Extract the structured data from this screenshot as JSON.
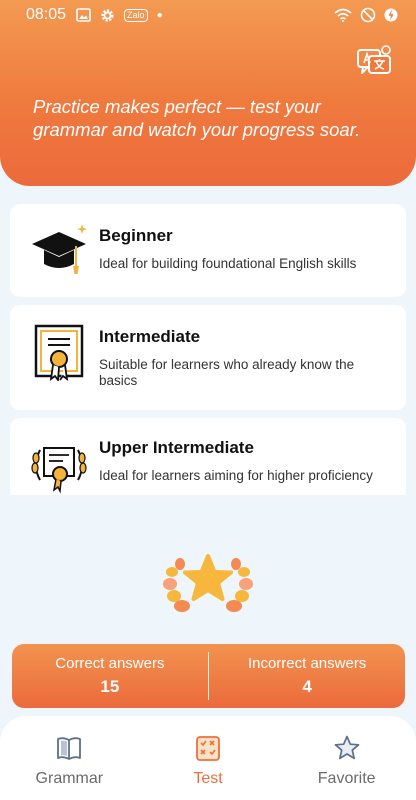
{
  "status_bar": {
    "time": "08:05",
    "left_icons": [
      "gallery-icon",
      "settings-gear-icon",
      "zalo-icon",
      "dot-icon"
    ],
    "zalo_label": "Zalo",
    "right_icons": [
      "wifi-icon",
      "do-not-disturb-icon",
      "battery-charging-icon"
    ]
  },
  "header": {
    "tagline": "Practice makes perfect — test your grammar and watch your progress soar.",
    "translate_icon": "translate-icon"
  },
  "levels": [
    {
      "title": "Beginner",
      "description": "Ideal for building foundational English skills",
      "icon": "graduation-cap-icon"
    },
    {
      "title": "Intermediate",
      "description": "Suitable for learners who already know the basics",
      "icon": "certificate-icon"
    },
    {
      "title": "Upper Intermediate",
      "description": "Ideal for learners aiming for higher proficiency",
      "icon": "laurel-certificate-icon"
    }
  ],
  "trophy_icon": "star-laurel-icon",
  "scores": {
    "correct_label": "Correct answers",
    "correct_value": "15",
    "incorrect_label": "Incorrect answers",
    "incorrect_value": "4"
  },
  "nav": {
    "items": [
      {
        "label": "Grammar",
        "icon": "book-icon",
        "active": false
      },
      {
        "label": "Test",
        "icon": "test-sheet-icon",
        "active": true
      },
      {
        "label": "Favorite",
        "icon": "star-outline-icon",
        "active": false
      }
    ]
  },
  "colors": {
    "accent": "#ef6f3f",
    "header_gradient_top": "#f39a52",
    "header_gradient_bottom": "#ec6a3c",
    "background": "#eef5fb",
    "gold": "#f3b33d"
  }
}
